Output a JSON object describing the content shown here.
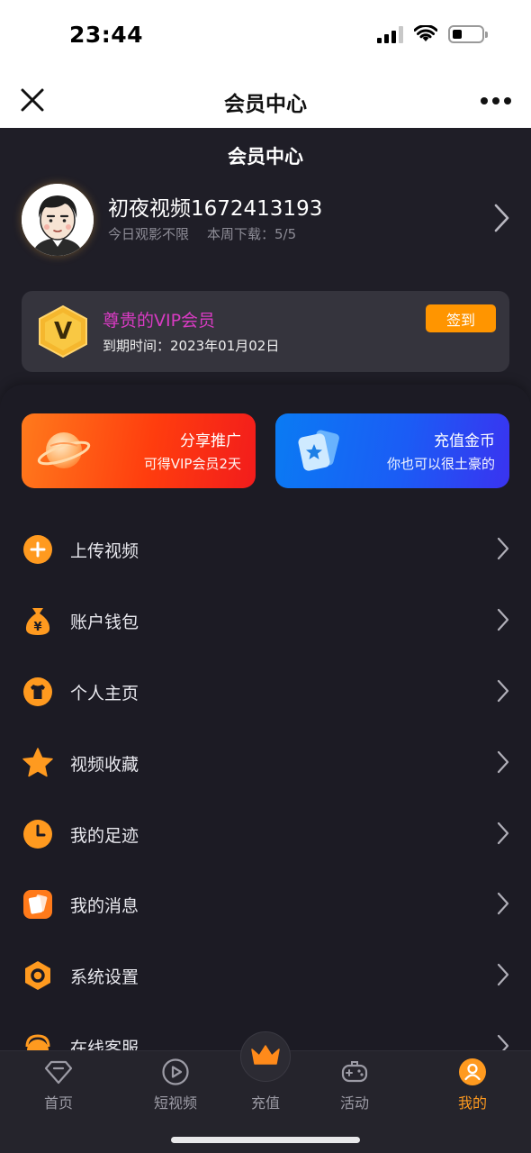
{
  "status_bar": {
    "time": "23:44"
  },
  "navbar": {
    "title": "会员中心"
  },
  "header": {
    "title": "会员中心",
    "username": "初夜视频1672413193",
    "stat_watch": "今日观影不限",
    "stat_download": "本周下载：5/5"
  },
  "vip": {
    "title": "尊贵的VIP会员",
    "expiry": "到期时间：2023年01月02日",
    "signin_label": "签到",
    "badge_letter": "V"
  },
  "promos": [
    {
      "title": "分享推广",
      "subtitle": "可得VIP会员2天",
      "icon": "planet-icon"
    },
    {
      "title": "充值金币",
      "subtitle": "你也可以很土豪的",
      "icon": "card-star-icon"
    }
  ],
  "menu": [
    {
      "label": "上传视频",
      "icon": "upload-plus-icon"
    },
    {
      "label": "账户钱包",
      "icon": "money-bag-icon"
    },
    {
      "label": "个人主页",
      "icon": "shirt-icon"
    },
    {
      "label": "视频收藏",
      "icon": "star-icon"
    },
    {
      "label": "我的足迹",
      "icon": "clock-icon"
    },
    {
      "label": "我的消息",
      "icon": "message-cards-icon"
    },
    {
      "label": "系统设置",
      "icon": "settings-hex-icon"
    },
    {
      "label": "在线客服",
      "icon": "support-icon"
    }
  ],
  "tabs": [
    {
      "label": "首页",
      "icon": "diamond-icon"
    },
    {
      "label": "短视频",
      "icon": "play-circle-icon"
    },
    {
      "label": "充值",
      "icon": "crown-icon"
    },
    {
      "label": "活动",
      "icon": "gamepad-icon"
    },
    {
      "label": "我的",
      "icon": "user-icon",
      "active": true
    }
  ],
  "colors": {
    "accent": "#ff9500",
    "vip_title": "#d93bc3",
    "background": "#1f1e27",
    "active_tab": "#ff9a1f"
  }
}
